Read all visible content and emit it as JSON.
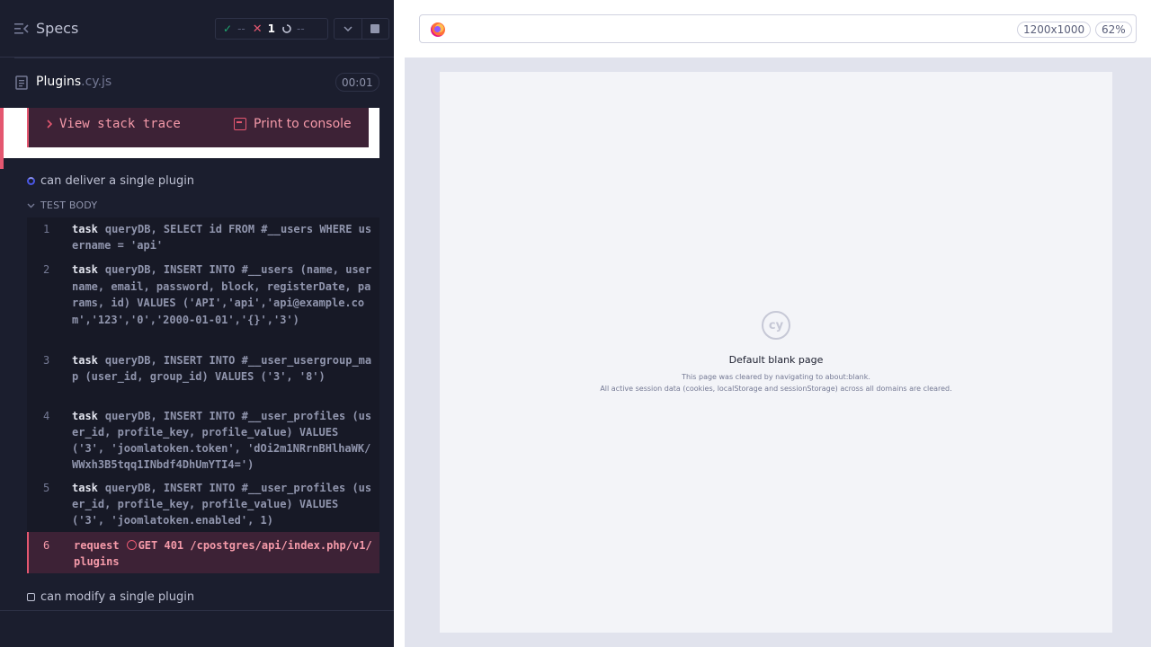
{
  "header": {
    "specs_label": "Specs",
    "passed_count": "--",
    "failed_count": "1",
    "pending_count": "--"
  },
  "spec": {
    "name": "Plugins",
    "ext": ".cy.js",
    "duration": "00:01"
  },
  "error": {
    "stack_trace_label": "View stack trace",
    "print_console_label": "Print to console"
  },
  "tests": [
    {
      "title": "can deliver a single plugin",
      "state": "running"
    },
    {
      "title": "can modify a single plugin",
      "state": "pending"
    }
  ],
  "test_body_label": "TEST BODY",
  "commands": [
    {
      "num": "1",
      "name": "task",
      "message": "queryDB, SELECT id FROM #__users WHERE username = 'api'"
    },
    {
      "num": "2",
      "name": "task",
      "message": "queryDB, INSERT INTO #__users (name, username, email, password, block, registerDate, params, id) VALUES ('API','api','api@example.com','123','0','2000-01-01','{}','3')"
    },
    {
      "num": "3",
      "name": "task",
      "message": "queryDB, INSERT INTO #__user_usergroup_map (user_id, group_id) VALUES ('3', '8')"
    },
    {
      "num": "4",
      "name": "task",
      "message": "queryDB, INSERT INTO #__user_profiles (user_id, profile_key, profile_value) VALUES ('3', 'joomlatoken.token', 'dOi2m1NRrnBHlhaWK/WWxh3B5tqq1INbdf4DhUmYTI4=')"
    },
    {
      "num": "5",
      "name": "task",
      "message": "queryDB, INSERT INTO #__user_profiles (user_id, profile_key, profile_value) VALUES ('3', 'joomlatoken.enabled', 1)"
    },
    {
      "num": "6",
      "name": "request",
      "message": "GET 401 /cpostgres/api/index.php/v1/plugins"
    }
  ],
  "aut": {
    "viewport": "1200x1000",
    "zoom": "62%",
    "blank_logo": "cy",
    "blank_title": "Default blank page",
    "blank_line1": "This page was cleared by navigating to about:blank.",
    "blank_line2": "All active session data (cookies, localStorage and sessionStorage) across all domains are cleared."
  },
  "colors": {
    "fail": "#e45770",
    "pass": "#1fa971",
    "running": "#4956e3",
    "bg": "#1b1e2e"
  }
}
